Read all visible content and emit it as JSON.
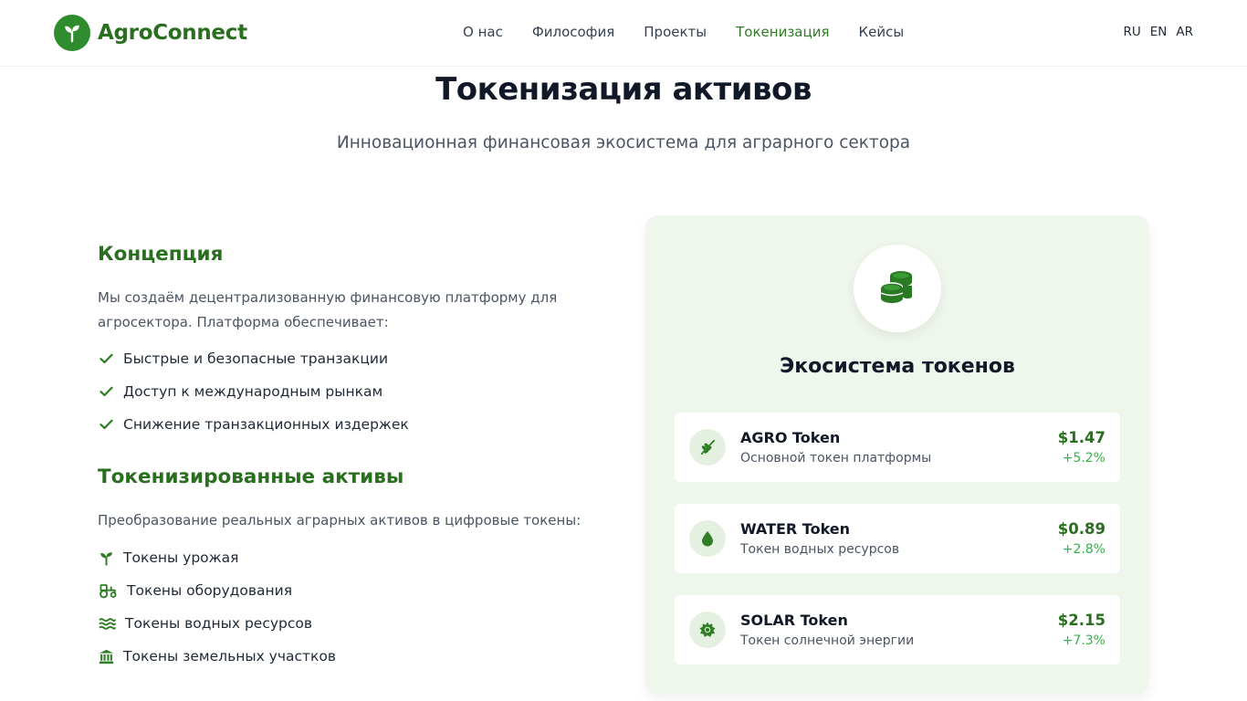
{
  "header": {
    "logo_text": "AgroConnect",
    "nav": [
      {
        "label": "О нас"
      },
      {
        "label": "Философия"
      },
      {
        "label": "Проекты"
      },
      {
        "label": "Токенизация"
      },
      {
        "label": "Кейсы"
      }
    ],
    "langs": [
      "RU",
      "EN",
      "AR"
    ]
  },
  "hero": {
    "title": "Токенизация активов",
    "subtitle": "Инновационная финансовая экосистема для аграрного сектора"
  },
  "concept": {
    "title": "Концепция",
    "text": "Мы создаём децентрализованную финансовую платформу для агросектора. Платформа обеспечивает:",
    "items": [
      "Быстрые и безопасные транзакции",
      "Доступ к международным рынкам",
      "Снижение транзакционных издержек"
    ]
  },
  "assets": {
    "title": "Токенизированные активы",
    "text": "Преобразование реальных аграрных активов в цифровые токены:",
    "items": [
      {
        "label": "Токены урожая",
        "icon": "seedling-icon"
      },
      {
        "label": "Токены оборудования",
        "icon": "tractor-icon"
      },
      {
        "label": "Токены водных ресурсов",
        "icon": "water-waves-icon"
      },
      {
        "label": "Токены земельных участков",
        "icon": "landmark-icon"
      }
    ]
  },
  "ecosystem": {
    "title": "Экосистема токенов",
    "tokens": [
      {
        "name": "AGRO Token",
        "desc": "Основной токен платформы",
        "price": "$1.47",
        "change": "+5.2%",
        "icon": "wheat-icon"
      },
      {
        "name": "WATER Token",
        "desc": "Токен водных ресурсов",
        "price": "$0.89",
        "change": "+2.8%",
        "icon": "droplet-icon"
      },
      {
        "name": "SOLAR Token",
        "desc": "Токен солнечной энергии",
        "price": "$2.15",
        "change": "+7.3%",
        "icon": "sun-icon"
      }
    ]
  },
  "colors": {
    "brand_green": "#2a6e1f",
    "accent_green": "#2e8b2e",
    "positive_change": "#34b349",
    "card_background": "#eff7ed"
  }
}
